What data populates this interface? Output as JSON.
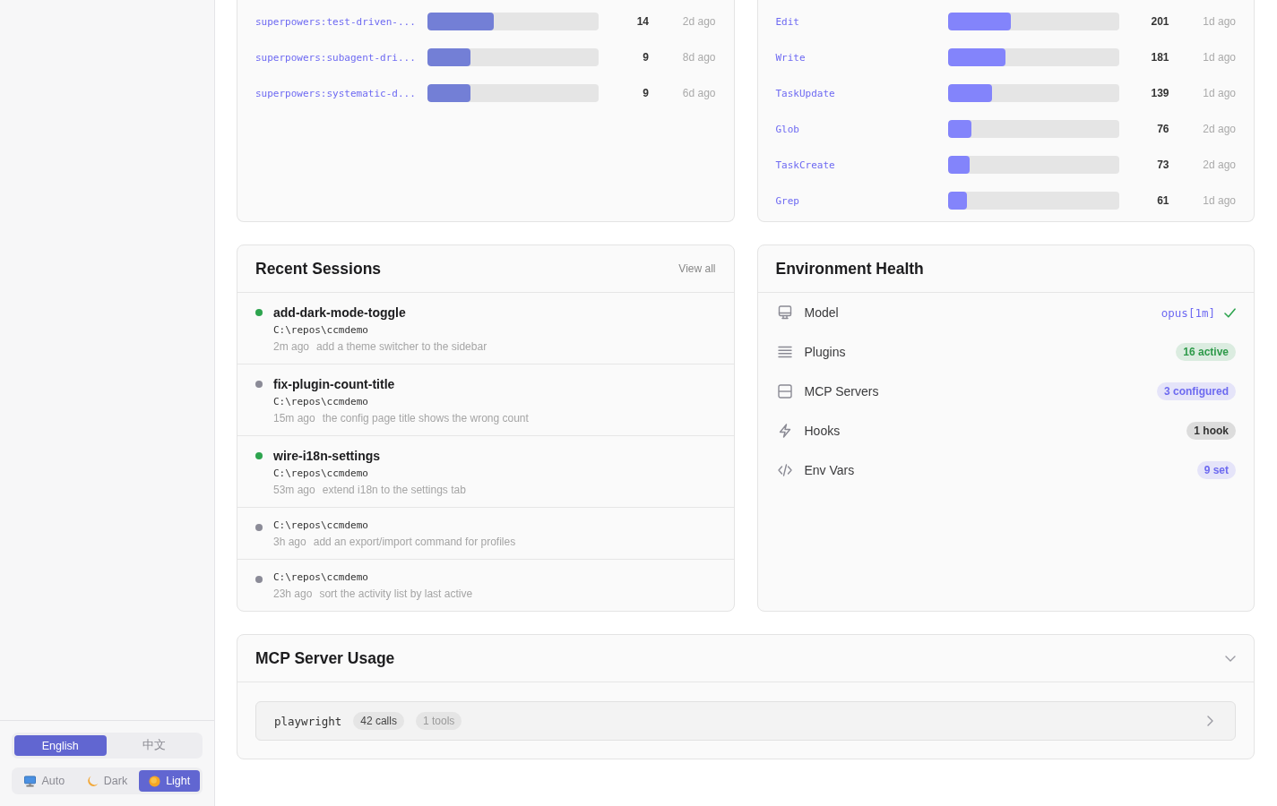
{
  "sidebar": {
    "language": [
      {
        "label": "English",
        "selected": true
      },
      {
        "label": "中文",
        "selected": false
      }
    ],
    "theme": [
      {
        "label": "Auto",
        "selected": false
      },
      {
        "label": "Dark",
        "selected": false
      },
      {
        "label": "Light",
        "selected": true
      }
    ]
  },
  "skill_usage": {
    "rows": [
      {
        "name": "superpowers:test-driven-...",
        "level": 0.39,
        "count": "14",
        "last_used": "2d ago"
      },
      {
        "name": "superpowers:subagent-dri...",
        "level": 0.25,
        "count": "9",
        "last_used": "8d ago"
      },
      {
        "name": "superpowers:systematic-d...",
        "level": 0.25,
        "count": "9",
        "last_used": "6d ago"
      }
    ]
  },
  "tool_usage": {
    "rows": [
      {
        "name": "Edit",
        "level": 0.37,
        "count": "201",
        "last_used": "1d ago"
      },
      {
        "name": "Write",
        "level": 0.34,
        "count": "181",
        "last_used": "1d ago"
      },
      {
        "name": "TaskUpdate",
        "level": 0.26,
        "count": "139",
        "last_used": "1d ago"
      },
      {
        "name": "Glob",
        "level": 0.14,
        "count": "76",
        "last_used": "2d ago"
      },
      {
        "name": "TaskCreate",
        "level": 0.13,
        "count": "73",
        "last_used": "2d ago"
      },
      {
        "name": "Grep",
        "level": 0.11,
        "count": "61",
        "last_used": "1d ago"
      }
    ]
  },
  "recent_sessions": {
    "title": "Recent Sessions",
    "link": "View all",
    "sessions": [
      {
        "name": "add-dark-mode-toggle",
        "path": "C:\\repos\\ccmdemo",
        "time": "2m ago",
        "summary": "add a theme switcher to the sidebar",
        "color": "#2da44e"
      },
      {
        "name": "fix-plugin-count-title",
        "path": "C:\\repos\\ccmdemo",
        "time": "15m ago",
        "summary": "the config page title shows the wrong count",
        "color": "#8b8b97"
      },
      {
        "name": "wire-i18n-settings",
        "path": "C:\\repos\\ccmdemo",
        "time": "53m ago",
        "summary": "extend i18n to the settings tab",
        "color": "#2da44e"
      },
      {
        "path": "C:\\repos\\ccmdemo",
        "time": "3h ago",
        "summary": "add an export/import command for profiles",
        "color": "#8b8b97"
      },
      {
        "path": "C:\\repos\\ccmdemo",
        "time": "23h ago",
        "summary": "sort the activity list by last active",
        "color": "#8b8b97"
      }
    ]
  },
  "environment_health": {
    "title": "Environment Health",
    "items": [
      {
        "kind": "value",
        "label": "Model",
        "value": "opus[1m]",
        "ok": true
      },
      {
        "kind": "badge",
        "label": "Plugins",
        "badge": "16 active",
        "color": "#2e9a4a"
      },
      {
        "kind": "badge",
        "label": "MCP Servers",
        "badge": "3 configured",
        "color": "#6d6af0"
      },
      {
        "kind": "badge",
        "label": "Hooks",
        "badge": "1 hook",
        "color": "#333333"
      },
      {
        "kind": "badge",
        "label": "Env Vars",
        "badge": "9 set",
        "color": "#6d6af0"
      }
    ]
  },
  "mcp_server_usage": {
    "title": "MCP Server Usage",
    "expanded": true,
    "servers": [
      {
        "name": "playwright",
        "calls": "42 calls",
        "tools": "1 tools",
        "expanded": false
      }
    ]
  }
}
